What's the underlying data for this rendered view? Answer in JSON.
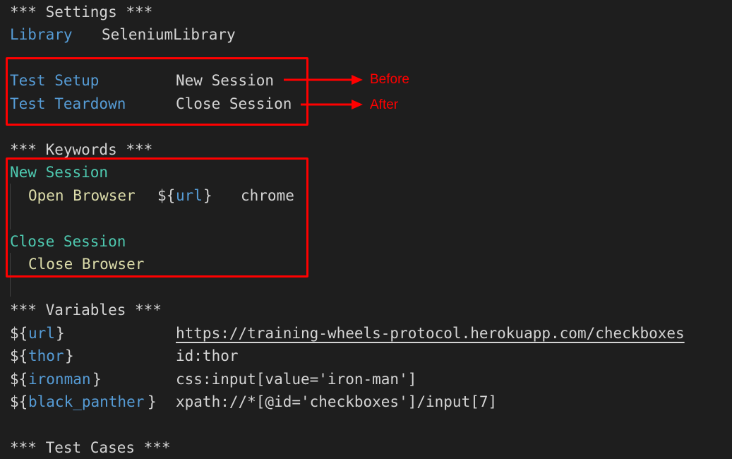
{
  "settings": {
    "header": "*** Settings ***",
    "library_key": "Library",
    "library_value": "SeleniumLibrary",
    "test_setup_key": "Test Setup",
    "test_setup_value": "New Session",
    "test_teardown_key": "Test Teardown",
    "test_teardown_value": "Close Session"
  },
  "annotations": {
    "before": "Before",
    "after": "After",
    "color": "#ff0000"
  },
  "keywords": {
    "header": "*** Keywords ***",
    "new_session_name": "New Session",
    "open_browser_kw": "Open Browser",
    "url_prefix": "${",
    "url_var": "url",
    "url_suffix": "}",
    "browser_arg": "chrome",
    "close_session_name": "Close Session",
    "close_browser_kw": "Close Browser"
  },
  "variables": {
    "header": "*** Variables ***",
    "items": [
      {
        "prefix": "${",
        "name": "url",
        "suffix": "}",
        "value": "https://training-wheels-protocol.herokuapp.com/checkboxes"
      },
      {
        "prefix": "${",
        "name": "thor",
        "suffix": "}",
        "value": "id:thor"
      },
      {
        "prefix": "${",
        "name": "ironman",
        "suffix": "}",
        "value": "css:input[value='iron-man']"
      },
      {
        "prefix": "${",
        "name": "black_panther",
        "suffix": "}",
        "value": "xpath://*[@id='checkboxes']/input[7]"
      }
    ]
  },
  "test_cases": {
    "header": "*** Test Cases ***"
  },
  "colors": {
    "background": "#1e1e1e",
    "setting_key": "#569cd6",
    "keyword_definition": "#4ec9b0",
    "keyword_call": "#dcdcaa",
    "variable_name": "#569cd6",
    "plain_text": "#d4d4d4",
    "highlight_box": "#ff0000"
  }
}
